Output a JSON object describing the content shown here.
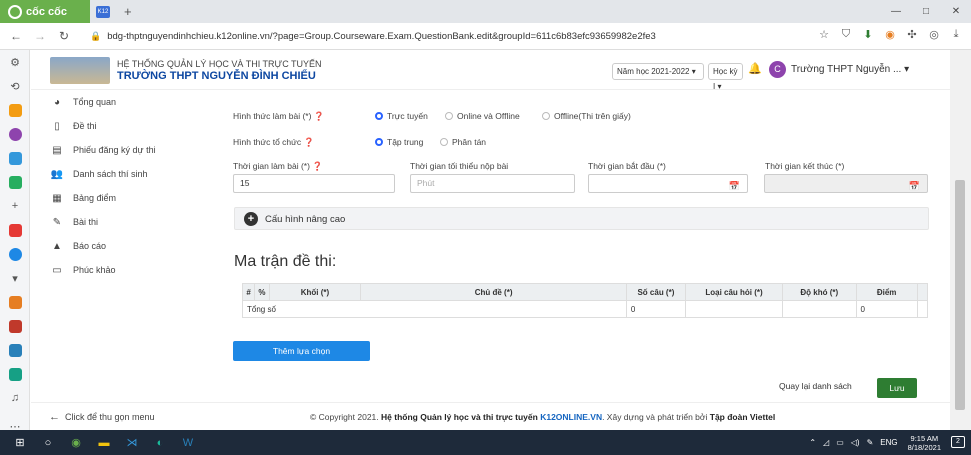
{
  "browser": {
    "brand": "cốc cốc",
    "tab_icon": "K12",
    "new_tab": "+",
    "url": "bdg-thptnguyendinhchieu.k12online.vn/?page=Group.Courseware.Exam.QuestionBank.edit&groupId=611c6b83efc93659982e2fe3",
    "window_controls": [
      "—",
      "□",
      "✕"
    ]
  },
  "header": {
    "system_title": "HỆ THỐNG QUẢN LÝ HỌC VÀ THI TRỰC TUYẾN",
    "school_name": "TRƯỜNG THPT NGUYỄN ĐÌNH CHIỂU",
    "school_year": "Năm học 2021-2022",
    "semester": "Học kỳ I",
    "avatar_letter": "C",
    "user_name": "Trường THPT Nguyễn ..."
  },
  "sidebar": {
    "items": [
      {
        "label": "Tổng quan",
        "icon": "pie-chart-icon"
      },
      {
        "label": "Đề thi",
        "icon": "file-icon"
      },
      {
        "label": "Phiếu đăng ký dự thi",
        "icon": "form-icon"
      },
      {
        "label": "Danh sách thí sinh",
        "icon": "users-icon"
      },
      {
        "label": "Bảng điểm",
        "icon": "table-icon"
      },
      {
        "label": "Bài thi",
        "icon": "edit-icon"
      },
      {
        "label": "Báo cáo",
        "icon": "chart-icon"
      },
      {
        "label": "Phúc khảo",
        "icon": "document-icon"
      }
    ]
  },
  "form": {
    "exam_mode_label": "Hình thức làm bài (*)",
    "exam_mode_options": [
      "Trực tuyến",
      "Online và Offline",
      "Offline(Thi trên giấy)"
    ],
    "exam_mode_selected": 0,
    "org_label": "Hình thức tổ chức",
    "org_options": [
      "Tập trung",
      "Phân tán"
    ],
    "org_selected": 0,
    "duration_label": "Thời gian làm bài (*)",
    "duration_value": "15",
    "min_submit_label": "Thời gian tối thiểu nộp bài",
    "min_submit_placeholder": "Phút",
    "start_label": "Thời gian bắt đầu (*)",
    "end_label": "Thời gian kết thúc (*)",
    "advanced_label": "Cấu hình nâng cao"
  },
  "matrix": {
    "title": "Ma trận đề thi:",
    "columns": [
      "#",
      "%",
      "Khối (*)",
      "Chủ đề (*)",
      "Số câu (*)",
      "Loại câu hỏi (*)",
      "Độ khó (*)",
      "Điểm"
    ],
    "total_label": "Tổng số",
    "total_count": "0",
    "total_points": "0",
    "add_button": "Thêm lựa chọn"
  },
  "actions": {
    "back": "Quay lại danh sách",
    "save": "Lưu"
  },
  "footer": {
    "collapse": "Click để thu gọn menu",
    "copy_prefix": "© Copyright 2021.",
    "system": "Hệ thống Quản lý học và thi trực tuyến",
    "brand": "K12ONLINE.VN",
    "dev_prefix": ". Xây dựng và phát triển bởi",
    "company": "Tập đoàn Viettel"
  },
  "taskbar": {
    "lang": "ENG",
    "time": "9:15 AM",
    "date": "8/18/2021",
    "notif": "2"
  },
  "colors": {
    "accent": "#1e88e5",
    "save": "#2e7d32",
    "school": "#0d47a1",
    "brand": "#6ab04c"
  }
}
